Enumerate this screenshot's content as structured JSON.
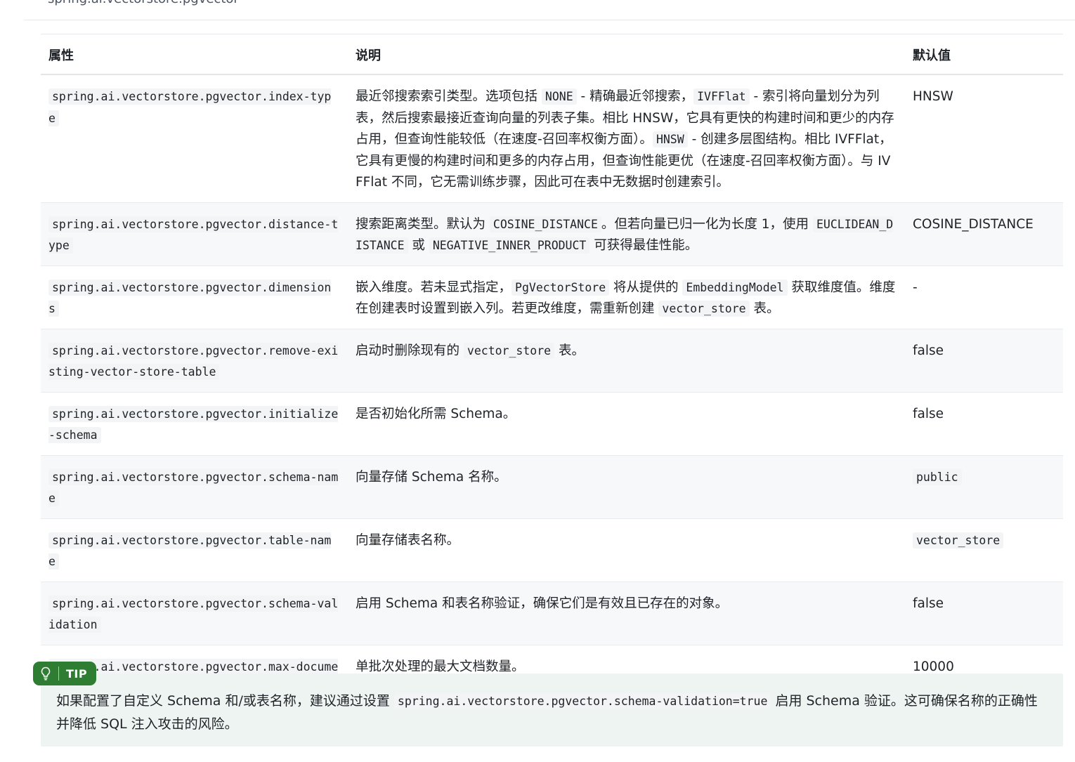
{
  "header_cut_text": "spring.ai.vectorstore.pgvector",
  "table": {
    "headers": {
      "property": "属性",
      "description": "说明",
      "default": "默认值"
    },
    "rows": [
      {
        "property": "spring.ai.vectorstore.pgvector.index-type",
        "desc": [
          "最近邻搜索索引类型。选项包括 ",
          "NONE",
          " - 精确最近邻搜索，",
          "IVFFlat",
          " - 索引将向量划分为列表，然后搜索最接近查询向量的列表子集。相比 HNSW，它具有更快的构建时间和更少的内存占用，但查询性能较低（在速度-召回率权衡方面）。",
          "HNSW",
          " - 创建多层图结构。相比 IVFFlat，它具有更慢的构建时间和更多的内存占用，但查询性能更优（在速度-召回率权衡方面）。与 IVFFlat 不同，它无需训练步骤，因此可在表中无数据时创建索引。"
        ],
        "default": "HNSW"
      },
      {
        "property": "spring.ai.vectorstore.pgvector.distance-type",
        "desc": [
          "搜索距离类型。默认为 ",
          "COSINE_DISTANCE",
          "。但若向量已归一化为长度 1，使用 ",
          "EUCLIDEAN_DISTANCE",
          " 或 ",
          "NEGATIVE_INNER_PRODUCT",
          " 可获得最佳性能。"
        ],
        "default": "COSINE_DISTANCE"
      },
      {
        "property": "spring.ai.vectorstore.pgvector.dimensions",
        "desc": [
          "嵌入维度。若未显式指定，",
          "PgVectorStore",
          " 将从提供的 ",
          "EmbeddingModel",
          " 获取维度值。维度在创建表时设置到嵌入列。若更改维度，需重新创建 ",
          "vector_store",
          " 表。"
        ],
        "default": "-"
      },
      {
        "property": "spring.ai.vectorstore.pgvector.remove-existing-vector-store-table",
        "desc": [
          "启动时删除现有的 ",
          "vector_store",
          " 表。"
        ],
        "default": "false"
      },
      {
        "property": "spring.ai.vectorstore.pgvector.initialize-schema",
        "desc": [
          "是否初始化所需 Schema。"
        ],
        "default": "false"
      },
      {
        "property": "spring.ai.vectorstore.pgvector.schema-name",
        "desc": [
          "向量存储 Schema 名称。"
        ],
        "default": "public",
        "default_code": true
      },
      {
        "property": "spring.ai.vectorstore.pgvector.table-name",
        "desc": [
          "向量存储表名称。"
        ],
        "default": "vector_store",
        "default_code": true
      },
      {
        "property": "spring.ai.vectorstore.pgvector.schema-validation",
        "desc": [
          "启用 Schema 和表名称验证，确保它们是有效且已存在的对象。"
        ],
        "default": "false"
      },
      {
        "property": "spring.ai.vectorstore.pgvector.max-document-batch-size",
        "desc": [
          "单批次处理的最大文档数量。"
        ],
        "default": "10000"
      }
    ]
  },
  "tip": {
    "label": "TIP",
    "icon": "lightbulb-icon",
    "accent_color": "#2f7d32",
    "background_color": "#eef4f1",
    "text_before": "如果配置了自定义 Schema 和/或表名称，建议通过设置 ",
    "code": "spring.ai.vectorstore.pgvector.schema-validation=true",
    "text_after": " 启用 Schema 验证。这可确保名称的正确性并降低 SQL 注入攻击的风险。"
  }
}
